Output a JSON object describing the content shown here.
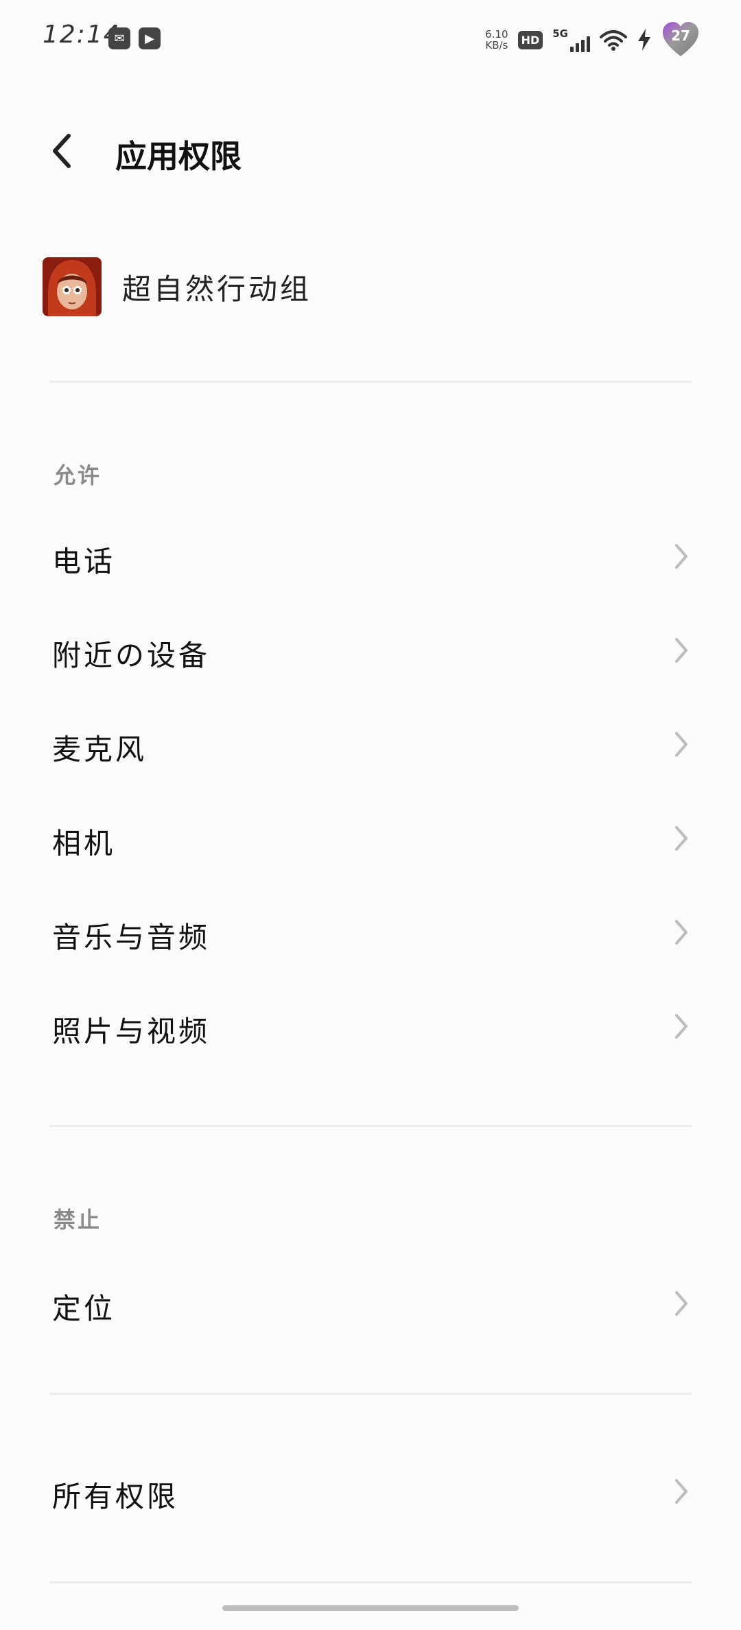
{
  "status_bar": {
    "time": "12:14",
    "net_speed_value": "6.10",
    "net_speed_unit": "KB/s",
    "hd_label": "HD",
    "network_label": "5G",
    "battery_level": "27"
  },
  "header": {
    "title": "应用权限"
  },
  "app": {
    "name": "超自然行动组"
  },
  "sections": {
    "allowed_label": "允许",
    "denied_label": "禁止"
  },
  "permissions": {
    "allowed": [
      {
        "label": "电话"
      },
      {
        "label": "附近の设备"
      },
      {
        "label": "麦克风"
      },
      {
        "label": "相机"
      },
      {
        "label": "音乐与音频"
      },
      {
        "label": "照片与视频"
      }
    ],
    "denied": [
      {
        "label": "定位"
      }
    ],
    "all": {
      "label": "所有权限"
    }
  },
  "colors": {
    "background": "#fbfbfb",
    "text_primary": "#111111",
    "text_section": "#8a8a8a",
    "divider": "#ececec",
    "chevron": "#bdbdbd"
  }
}
